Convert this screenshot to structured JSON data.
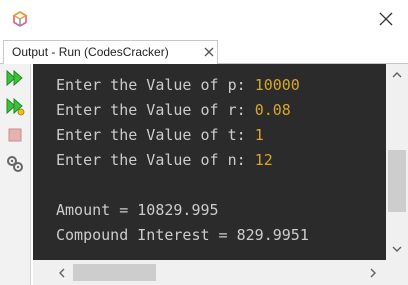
{
  "window": {
    "app_icon": "netbeans-cube-icon",
    "close_icon": "close-icon"
  },
  "tab": {
    "label": "Output - Run (CodesCracker)",
    "close_icon": "tab-close-icon"
  },
  "toolbar": {
    "items": [
      "rerun-icon",
      "rerun-with-options-icon",
      "stop-icon",
      "settings-icon"
    ]
  },
  "console": {
    "inputs": [
      {
        "prompt": "Enter the Value of p: ",
        "value": "10000"
      },
      {
        "prompt": "Enter the Value of r: ",
        "value": "0.08"
      },
      {
        "prompt": "Enter the Value of t: ",
        "value": "1"
      },
      {
        "prompt": "Enter the Value of n: ",
        "value": "12"
      }
    ],
    "amount_line": "Amount = 10829.995",
    "interest_line": "Compound Interest = 829.9951"
  },
  "colors": {
    "console_bg": "#2b2b2b",
    "console_text": "#cccccc",
    "input_value": "#d8a52b"
  }
}
